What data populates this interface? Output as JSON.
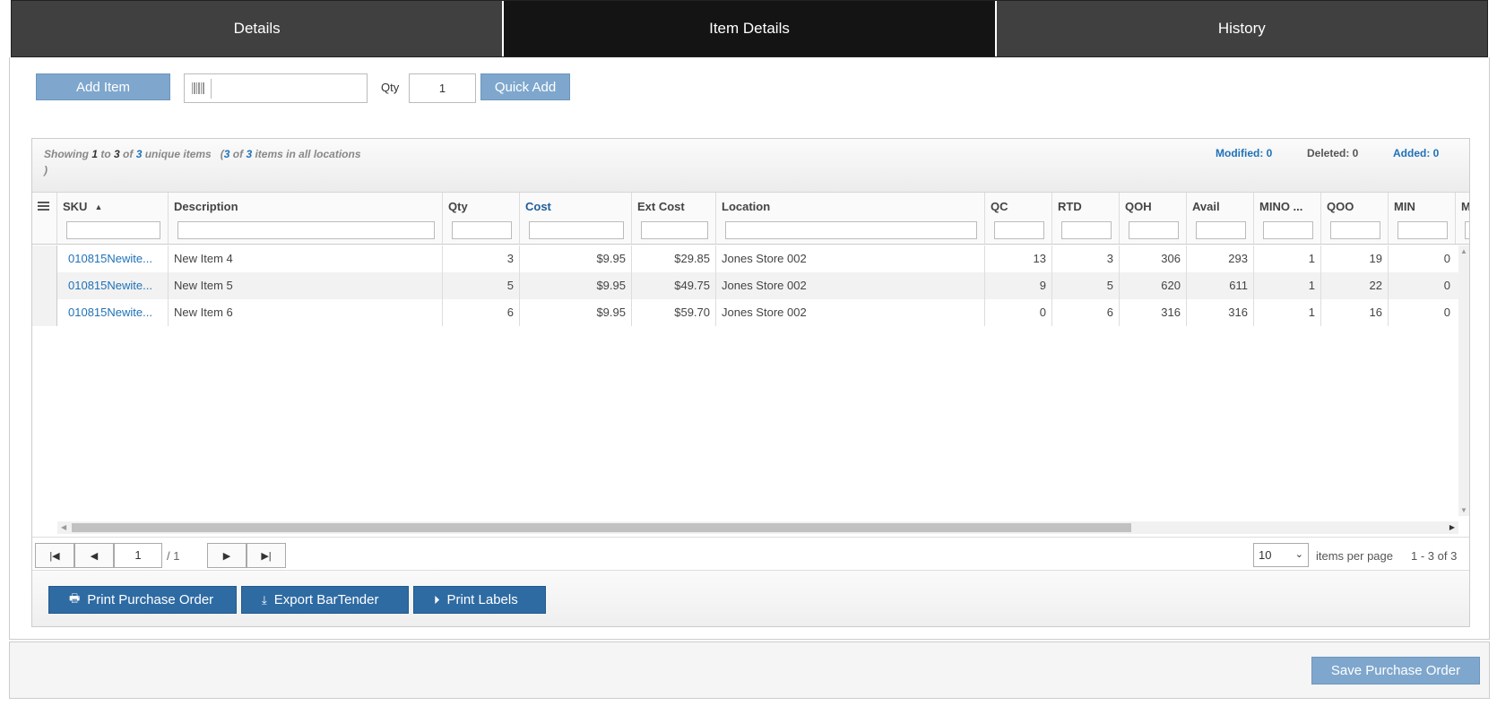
{
  "tabs": [
    {
      "label": "Details"
    },
    {
      "label": "Item Details"
    },
    {
      "label": "History"
    }
  ],
  "toolbar": {
    "add_item_label": "Add Item",
    "qty_label": "Qty",
    "qty_value": "1",
    "quick_add_label": "Quick Add"
  },
  "grid": {
    "showing": {
      "prefix": "Showing ",
      "from": "1",
      "to_word": " to ",
      "to": "3",
      "of_word": " of ",
      "total": "3",
      "unique": " unique items",
      "paren_open": "(",
      "loc_from": "3",
      "loc_of": " of ",
      "loc_total": "3",
      "loc_suffix": " items in all locations",
      "paren_close": ")"
    },
    "modified": "Modified: 0",
    "deleted": "Deleted: 0",
    "added": "Added: 0",
    "columns": [
      "SKU",
      "Description",
      "Qty",
      "Cost",
      "Ext Cost",
      "Location",
      "QC",
      "RTD",
      "QOH",
      "Avail",
      "MINO ...",
      "QOO",
      "MIN",
      "M"
    ],
    "rows": [
      {
        "sku": "010815Newite...",
        "description": "New Item 4",
        "qty": "3",
        "cost": "$9.95",
        "ext_cost": "$29.85",
        "location": "Jones Store 002",
        "qc": "13",
        "rtd": "3",
        "qoh": "306",
        "avail": "293",
        "mino": "1",
        "qoo": "19",
        "min": "0"
      },
      {
        "sku": "010815Newite...",
        "description": "New Item 5",
        "qty": "5",
        "cost": "$9.95",
        "ext_cost": "$49.75",
        "location": "Jones Store 002",
        "qc": "9",
        "rtd": "5",
        "qoh": "620",
        "avail": "611",
        "mino": "1",
        "qoo": "22",
        "min": "0"
      },
      {
        "sku": "010815Newite...",
        "description": "New Item 6",
        "qty": "6",
        "cost": "$9.95",
        "ext_cost": "$59.70",
        "location": "Jones Store 002",
        "qc": "0",
        "rtd": "6",
        "qoh": "316",
        "avail": "316",
        "mino": "1",
        "qoo": "16",
        "min": "0"
      }
    ],
    "pager": {
      "page": "1",
      "total_pages": "/ 1",
      "per_page": "10",
      "per_page_label": "items per page",
      "range": "1 - 3 of 3"
    }
  },
  "actions": {
    "print_po": "Print Purchase Order",
    "export_bartender": "Export BarTender",
    "print_labels": "Print Labels"
  },
  "save_label": "Save Purchase Order",
  "colors": {
    "tab_bg": "#404040",
    "tab_active_bg": "#141414",
    "link_blue": "#1f72b8",
    "button_blue": "#2f6ba3",
    "button_light_blue": "#7fa7cd"
  }
}
